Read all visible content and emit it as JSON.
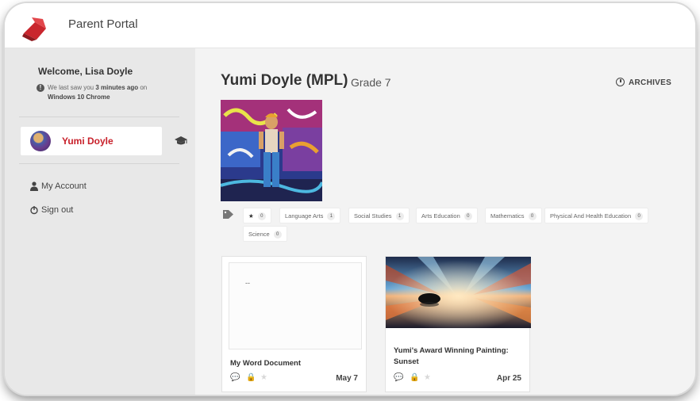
{
  "header": {
    "app_title": "Parent Portal"
  },
  "sidebar": {
    "welcome": "Welcome, Lisa Doyle",
    "last_seen_prefix": "We last saw you ",
    "last_seen_when": "3 minutes ago",
    "last_seen_mid": " on",
    "last_seen_device": "Windows 10 Chrome",
    "student_name": "Yumi Doyle",
    "menu": [
      {
        "label": "My Account",
        "icon": "user-icon"
      },
      {
        "label": "Sign out",
        "icon": "sign-out-icon"
      }
    ]
  },
  "main": {
    "student_heading": "Yumi Doyle (MPL)",
    "grade": "Grade 7",
    "archives_label": "ARCHIVES",
    "tags": [
      {
        "label": "★",
        "count": "0"
      },
      {
        "label": "Language Arts",
        "count": "1"
      },
      {
        "label": "Social Studies",
        "count": "1"
      },
      {
        "label": "Arts Education",
        "count": "0"
      },
      {
        "label": "Mathematics",
        "count": "0"
      },
      {
        "label": "Physical And Health Education",
        "count": "0"
      },
      {
        "label": "Science",
        "count": "0"
      }
    ],
    "cards": [
      {
        "title": "My Word Document",
        "date": "May 7",
        "preview_text": "--"
      },
      {
        "title": "Yumi's Award Winning Painting: Sunset",
        "date": "Apr 25"
      }
    ]
  },
  "colors": {
    "accent_red": "#c8202a",
    "sidebar_bg": "#e8e8e8",
    "main_bg": "#f3f3f3"
  }
}
